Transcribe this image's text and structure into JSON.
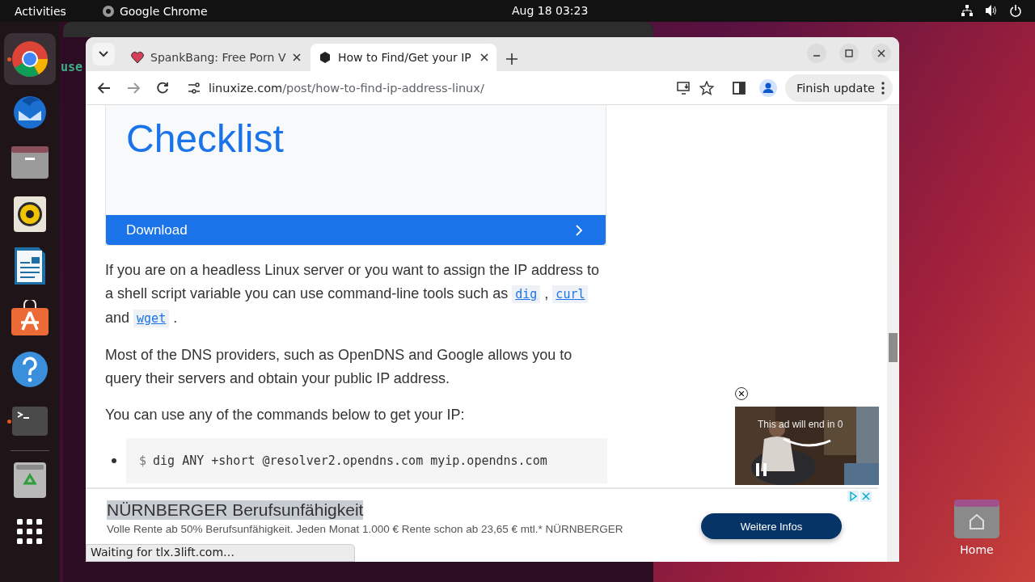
{
  "top_bar": {
    "activities": "Activities",
    "app": "Google Chrome",
    "clock": "Aug 18  03:23"
  },
  "dock": {
    "items": [
      {
        "kind": "chrome",
        "running": true
      },
      {
        "kind": "mail",
        "running": false
      },
      {
        "kind": "files",
        "running": false
      },
      {
        "kind": "speaker",
        "running": false
      },
      {
        "kind": "writer",
        "running": false
      },
      {
        "kind": "store",
        "running": false
      },
      {
        "kind": "help",
        "running": false
      },
      {
        "kind": "terminal",
        "running": true
      },
      {
        "kind": "trash",
        "running": false
      },
      {
        "kind": "apps",
        "running": false
      }
    ]
  },
  "background_terminal": {
    "text": "use"
  },
  "desktop": {
    "home_label": "Home"
  },
  "browser": {
    "tabs": [
      {
        "title": "SpankBang: Free Porn V",
        "selected": false
      },
      {
        "title": "How to Find/Get your IP",
        "selected": true
      }
    ],
    "url_domain": "linuxize.com",
    "url_path": "/post/how-to-find-ip-address-linux/",
    "update_button": "Finish update",
    "status": "Waiting for tlx.3lift.com…"
  },
  "article": {
    "banner_title": "Checklist",
    "banner_button": "Download",
    "paragraphs": [
      {
        "parts": [
          {
            "kind": "text",
            "text": "If you are on a headless Linux server or you want to assign the IP address to a shell script variable you can use command-line tools such as "
          },
          {
            "kind": "code",
            "text": "dig"
          },
          {
            "kind": "text",
            "text": " , "
          },
          {
            "kind": "code",
            "text": "curl"
          },
          {
            "kind": "text",
            "text": " and "
          },
          {
            "kind": "code",
            "text": "wget"
          },
          {
            "kind": "text",
            "text": " ."
          }
        ]
      },
      {
        "parts": [
          {
            "kind": "text",
            "text": "Most of the DNS providers, such as OpenDNS and Google allows you to query their servers and obtain your public IP address."
          }
        ]
      },
      {
        "parts": [
          {
            "kind": "text",
            "text": "You can use any of the commands below to get your IP:"
          }
        ]
      }
    ],
    "commands": [
      {
        "prompt": "$",
        "command": "dig ANY +short @resolver2.opendns.com myip.opendns.com"
      }
    ]
  },
  "video_ad": {
    "caption": "This ad will end in 0"
  },
  "banner_ad": {
    "title": "NÜRNBERGER Berufsunfähigkeit",
    "text": "Volle Rente ab 50% Berufsunfähigkeit. Jeden Monat 1.000 € Rente schon ab 23,65 € mtl.* NÜRNBERGER",
    "button": "Weitere Infos"
  }
}
